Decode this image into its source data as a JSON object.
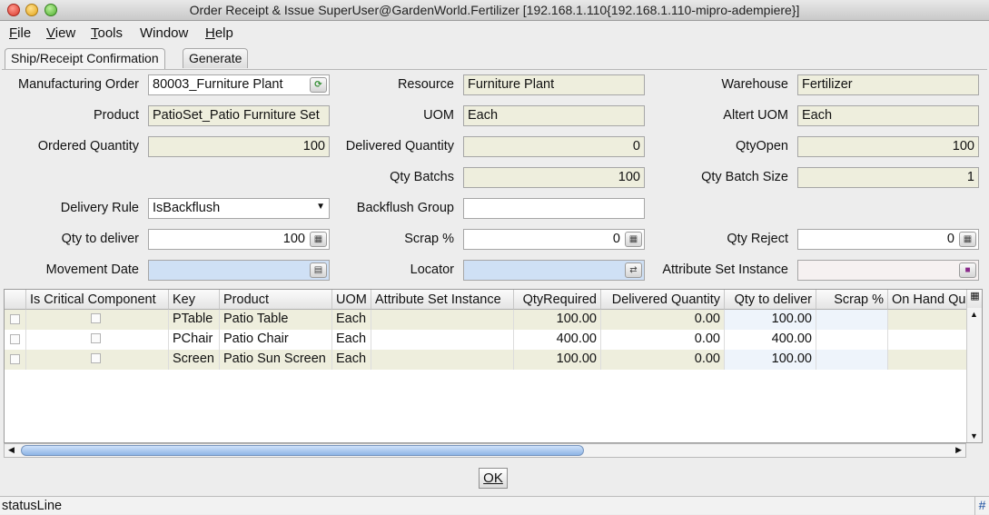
{
  "window": {
    "title": "Order Receipt & Issue  SuperUser@GardenWorld.Fertilizer [192.168.1.110{192.168.1.110-mipro-adempiere}]"
  },
  "menu": {
    "file_first": "F",
    "file_rest": "ile",
    "view_first": "V",
    "view_rest": "iew",
    "tools_first": "T",
    "tools_rest": "ools",
    "window": "Window",
    "help_first": "H",
    "help_rest": "elp"
  },
  "tabs": {
    "confirmation": "Ship/Receipt Confirmation",
    "generate": "Generate"
  },
  "form": {
    "manufacturing_order_label": "Manufacturing Order",
    "manufacturing_order_value": "80003_Furniture Plant",
    "resource_label": "Resource",
    "resource_value": "Furniture Plant",
    "warehouse_label": "Warehouse",
    "warehouse_value": "Fertilizer",
    "product_label": "Product",
    "product_value": "PatioSet_Patio Furniture Set",
    "uom_label": "UOM",
    "uom_value": "Each",
    "altert_uom_label": "Altert UOM",
    "altert_uom_value": "Each",
    "ordered_qty_label": "Ordered Quantity",
    "ordered_qty_value": "100",
    "delivered_qty_label": "Delivered Quantity",
    "delivered_qty_value": "0",
    "qty_open_label": "QtyOpen",
    "qty_open_value": "100",
    "qty_batchs_label": "Qty Batchs",
    "qty_batchs_value": "100",
    "qty_batch_size_label": "Qty Batch Size",
    "qty_batch_size_value": "1",
    "delivery_rule_label": "Delivery Rule",
    "delivery_rule_value": "IsBackflush",
    "backflush_group_label": "Backflush Group",
    "backflush_group_value": "",
    "qty_to_deliver_label": "Qty to deliver",
    "qty_to_deliver_value": "100",
    "scrap_label": "Scrap %",
    "scrap_value": "0",
    "qty_reject_label": "Qty Reject",
    "qty_reject_value": "0",
    "movement_date_label": "Movement Date",
    "movement_date_value": "",
    "locator_label": "Locator",
    "locator_value": "",
    "attribute_set_instance_label": "Attribute Set Instance",
    "attribute_set_instance_value": ""
  },
  "table": {
    "columns": [
      "Is Critical Component",
      "Key",
      "Product",
      "UOM",
      "Attribute Set Instance",
      "QtyRequired",
      "Delivered Quantity",
      "Qty to deliver",
      "Scrap %",
      "On Hand Qu"
    ],
    "rows": [
      {
        "key": "PTable",
        "product": "Patio Table",
        "uom": "Each",
        "asi": "",
        "qty_required": "100.00",
        "delivered": "0.00",
        "to_deliver": "100.00",
        "scrap": "",
        "on_hand": ""
      },
      {
        "key": "PChair",
        "product": "Patio Chair",
        "uom": "Each",
        "asi": "",
        "qty_required": "400.00",
        "delivered": "0.00",
        "to_deliver": "400.00",
        "scrap": "",
        "on_hand": ""
      },
      {
        "key": "Screen",
        "product": "Patio Sun Screen",
        "uom": "Each",
        "asi": "",
        "qty_required": "100.00",
        "delivered": "0.00",
        "to_deliver": "100.00",
        "scrap": "",
        "on_hand": ""
      }
    ]
  },
  "buttons": {
    "ok": "OK"
  },
  "status": {
    "text": "statusLine",
    "hash": "#"
  },
  "colors": {
    "readonly_field": "#eeeedd",
    "mandatory_field": "#cfe0f5",
    "row_stripe": "#eeeedd"
  }
}
